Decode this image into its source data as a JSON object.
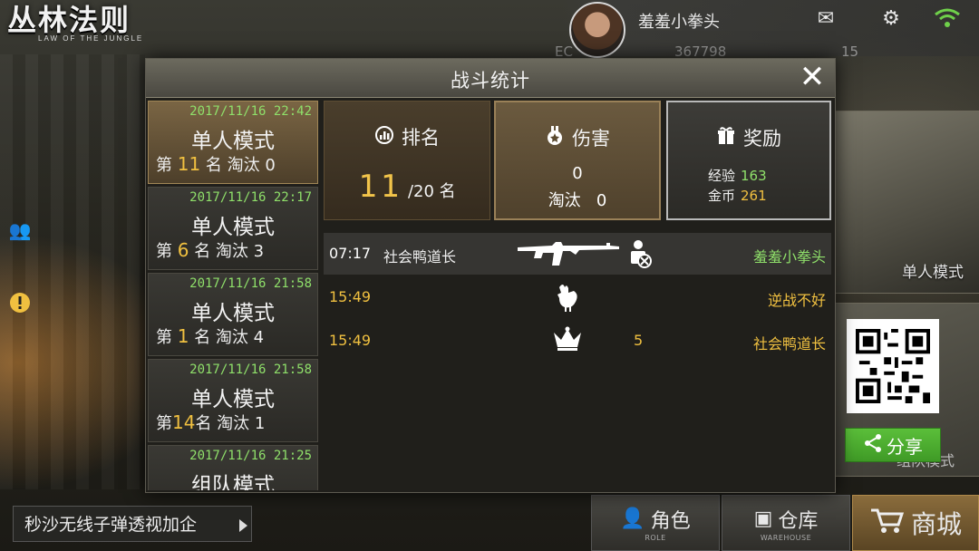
{
  "header": {
    "logo_title": "丛林法则",
    "logo_subtitle": "LAW OF THE JUNGLE",
    "player_name": "羞羞小拳头",
    "coins": "367798",
    "currency_left": "EC",
    "currency_right": "15"
  },
  "sidebar_right": {
    "card1_label": "单人模式",
    "card2_label": "组队模式",
    "share_label": "分享"
  },
  "bottom": {
    "ticker_text": "秒沙无线子弹透视加企",
    "role_label": "角色",
    "role_sub": "ROLE",
    "warehouse_label": "仓库",
    "warehouse_sub": "WAREHOUSE",
    "shop_label": "商城"
  },
  "modal": {
    "title": "战斗统计",
    "close_label": "✕",
    "matches": [
      {
        "time": "2017/11/16 22:42",
        "mode": "单人模式",
        "rank_prefix": "第",
        "rank": "11",
        "rank_suffix": "名 淘汰",
        "kills": "0",
        "active": true
      },
      {
        "time": "2017/11/16 22:17",
        "mode": "单人模式",
        "rank_prefix": "第",
        "rank": "6",
        "rank_suffix": "名 淘汰",
        "kills": "3",
        "active": false
      },
      {
        "time": "2017/11/16 21:58",
        "mode": "单人模式",
        "rank_prefix": "第",
        "rank": "1",
        "rank_suffix": "名 淘汰",
        "kills": "4",
        "active": false
      },
      {
        "time": "2017/11/16 21:58",
        "mode": "单人模式",
        "rank_prefix": "第",
        "rank": "14",
        "rank_suffix": "名 淘汰",
        "kills": "1",
        "active": false
      },
      {
        "time": "2017/11/16 21:25",
        "mode": "组队模式",
        "rank_prefix": "",
        "rank": "",
        "rank_suffix": "",
        "kills": "",
        "active": false
      }
    ],
    "stats": {
      "rank_label": "排名",
      "rank_value": "11",
      "rank_total": "/20 名",
      "damage_label": "伤害",
      "damage_value": "0",
      "kills_label": "淘汰",
      "kills_value": "0",
      "reward_label": "奖励",
      "exp_label": "经验",
      "exp_value": "163",
      "gold_label": "金币",
      "gold_value": "261"
    },
    "events": [
      {
        "time": "07:17",
        "actor": "社会鸭道长",
        "icon": "rifle-icon",
        "icon2": "eliminated-icon",
        "count": "",
        "target": "羞羞小拳头",
        "time_color": "#ffffff",
        "target_color": "#8fe06a"
      },
      {
        "time": "15:49",
        "actor": "",
        "icon": "chicken-icon",
        "icon2": "",
        "count": "",
        "target": "逆战不好",
        "time_color": "#f0c040",
        "target_color": "#f0c040"
      },
      {
        "time": "15:49",
        "actor": "",
        "icon": "crown-icon",
        "icon2": "",
        "count": "5",
        "target": "社会鸭道长",
        "time_color": "#f0c040",
        "target_color": "#f0c040"
      }
    ]
  },
  "colors": {
    "accent_gold": "#f0c040",
    "accent_green": "#8fe06a",
    "share_green": "#4fae30"
  }
}
